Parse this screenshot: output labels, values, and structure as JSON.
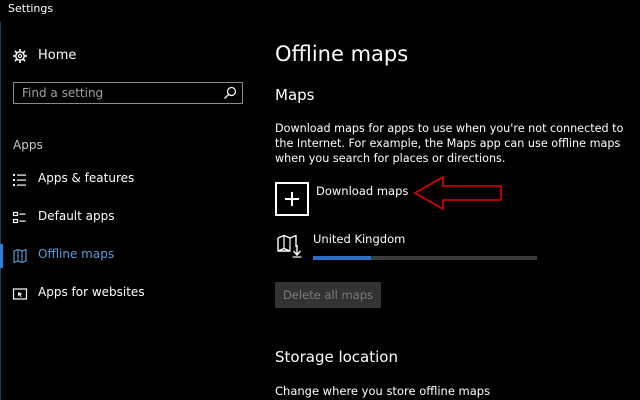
{
  "window": {
    "title": "Settings"
  },
  "sidebar": {
    "home_label": "Home",
    "search": {
      "placeholder": "Find a setting",
      "value": ""
    },
    "section_label": "Apps",
    "items": [
      {
        "label": "Apps & features",
        "icon": "list-icon",
        "selected": false
      },
      {
        "label": "Default apps",
        "icon": "default-apps-icon",
        "selected": false
      },
      {
        "label": "Offline maps",
        "icon": "map-icon",
        "selected": true
      },
      {
        "label": "Apps for websites",
        "icon": "website-app-icon",
        "selected": false
      }
    ]
  },
  "main": {
    "title": "Offline maps",
    "maps_heading": "Maps",
    "description": "Download maps for apps to use when you're not connected to the Internet. For example, the Maps app can use offline maps when you search for places or directions.",
    "download_label": "Download maps",
    "downloaded_maps": [
      {
        "name": "United Kingdom",
        "progress": 0.26
      }
    ],
    "delete_all_label": "Delete all maps",
    "storage_heading": "Storage location",
    "storage_description": "Change where you store offline maps"
  },
  "colors": {
    "background": "#000000",
    "accent": "#2d7fd8",
    "selected_text": "#5b9bd8",
    "annotation": "#e00000",
    "progress_fill": "#2a6fc7",
    "progress_track": "#3c3c3c",
    "disabled_button": "#333333"
  }
}
